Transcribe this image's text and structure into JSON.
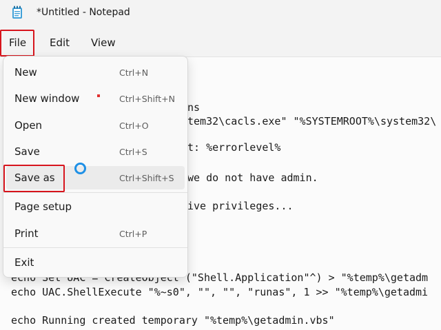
{
  "window": {
    "title": "*Untitled - Notepad"
  },
  "menubar": {
    "items": [
      "File",
      "Edit",
      "View"
    ]
  },
  "file_menu": {
    "items": [
      {
        "label": "New",
        "shortcut": "Ctrl+N"
      },
      {
        "label": "New window",
        "shortcut": "Ctrl+Shift+N"
      },
      {
        "label": "Open",
        "shortcut": "Ctrl+O"
      },
      {
        "label": "Save",
        "shortcut": "Ctrl+S"
      },
      {
        "label": "Save as",
        "shortcut": "Ctrl+Shift+S"
      },
      {
        "label": "Page setup",
        "shortcut": ""
      },
      {
        "label": "Print",
        "shortcut": "Ctrl+P"
      },
      {
        "label": "Exit",
        "shortcut": ""
      }
    ]
  },
  "editor": {
    "lines": [
      "ns",
      "tem32\\cacls.exe\" \"%SYSTEMROOT%\\system32\\",
      "t: %errorlevel%",
      "we do not have admin.",
      "ive privileges...",
      "echo Set UAC = CreateObject^(\"Shell.Application\"^) > \"%temp%\\getadm",
      "echo UAC.ShellExecute \"%~s0\", \"\", \"\", \"runas\", 1 >> \"%temp%\\getadmi",
      "echo Running created temporary \"%temp%\\getadmin.vbs\""
    ]
  },
  "icons": {
    "app": "notepad-icon"
  },
  "colors": {
    "highlight": "#d7141c",
    "cursor": "#1e90e6",
    "menu_hover": "#ebebeb"
  }
}
